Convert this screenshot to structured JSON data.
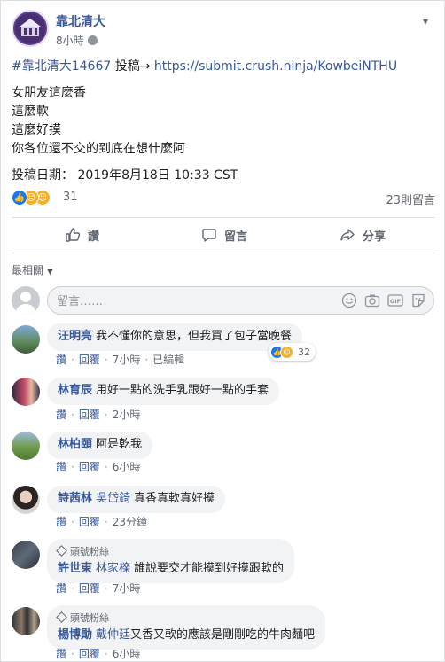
{
  "post": {
    "page_name": "靠北清大",
    "time": "8小時",
    "hashtag": "#靠北清大14667",
    "submit_label": "投稿→",
    "submit_url": "https://submit.crush.ninja/KowbeiNTHU",
    "lines": [
      "女朋友這麼香",
      "這麼軟",
      "這麼好摸",
      "你各位還不交的到底在想什麼阿"
    ],
    "date_line": "投稿日期： 2019年8月18日 10:33 CST",
    "reaction_count": "31",
    "comment_count": "23則留言"
  },
  "actions": {
    "like": "讚",
    "comment": "留言",
    "share": "分享"
  },
  "comments_section": {
    "sort_label": "最相關",
    "placeholder": "留言……"
  },
  "comments": [
    {
      "name": "汪明亮",
      "text": "我不懂你的意思，但我買了包子當晚餐",
      "like": "讚",
      "reply": "回覆",
      "time": "7小時",
      "edited": "已編輯",
      "reactions": "32"
    },
    {
      "name": "林育辰",
      "text": "用好一點的洗手乳跟好一點的手套",
      "like": "讚",
      "reply": "回覆",
      "time": "2小時"
    },
    {
      "name": "林柏頤",
      "text": "阿是乾我",
      "like": "讚",
      "reply": "回覆",
      "time": "6小時"
    },
    {
      "name": "詩茜林",
      "mention": "吳岱錡",
      "text": "真香真軟真好摸",
      "like": "讚",
      "reply": "回覆",
      "time": "23分鐘"
    },
    {
      "badge": "頭號粉絲",
      "name": "許世東",
      "mention": "林家檪",
      "text": "誰說要交才能摸到好摸跟軟的",
      "like": "讚",
      "reply": "回覆",
      "time": "7小時"
    },
    {
      "badge": "頭號粉絲",
      "name": "楊博勛",
      "mention": "戴仲廷",
      "text": "又香又軟的應該是剛剛吃的牛肉麵吧",
      "like": "讚",
      "reply": "回覆",
      "time": "6小時"
    }
  ],
  "colors": {
    "link": "#385898",
    "like_blue": "#1877f2",
    "emoji_yellow": "#f7b125",
    "bubble": "#f2f3f5"
  }
}
